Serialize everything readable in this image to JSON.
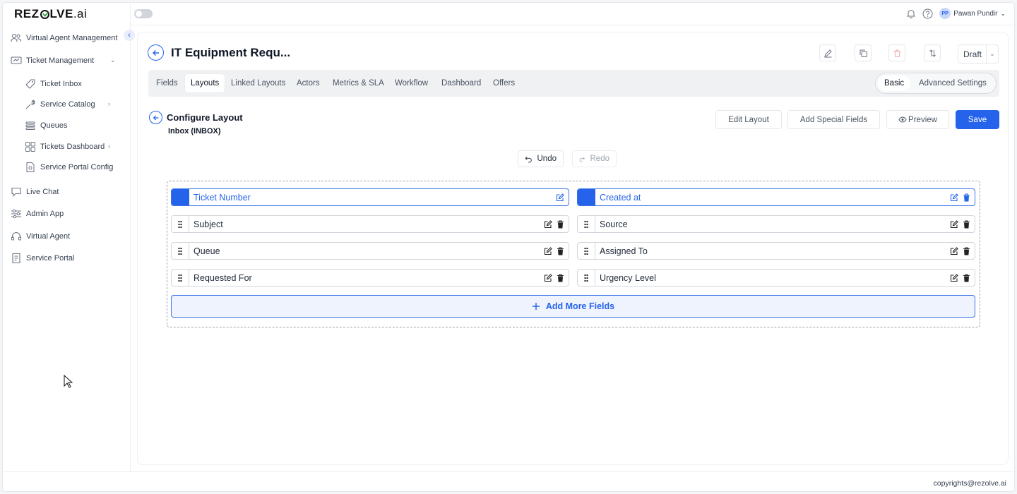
{
  "brand": {
    "logo_pre": "REZ",
    "logo_post": "LVE",
    "logo_ai": ".ai"
  },
  "sidebar": {
    "items": [
      {
        "label": "Virtual Agent Management",
        "icon": "users-gear-icon"
      },
      {
        "label": "Ticket Management",
        "icon": "ticket-screen-icon"
      },
      {
        "label": "Ticket Inbox",
        "icon": "tag-icon"
      },
      {
        "label": "Service Catalog",
        "icon": "wrench-icon"
      },
      {
        "label": "Queues",
        "icon": "stack-icon"
      },
      {
        "label": "Tickets Dashboard",
        "icon": "grid-icon"
      },
      {
        "label": "Service Portal Config",
        "icon": "doc-gear-icon"
      },
      {
        "label": "Live Chat",
        "icon": "chat-icon"
      },
      {
        "label": "Admin App",
        "icon": "sliders-icon"
      },
      {
        "label": "Virtual Agent",
        "icon": "headset-icon"
      },
      {
        "label": "Service Portal",
        "icon": "portal-icon"
      }
    ]
  },
  "topbar": {
    "avatar_initials": "PP",
    "user_name": "Pawan Pundir"
  },
  "header": {
    "title": "IT Equipment Requ...",
    "status": "Draft"
  },
  "tabs": [
    "Fields",
    "Layouts",
    "Linked Layouts",
    "Actors",
    "Metrics & SLA",
    "Workflow",
    "Dashboard",
    "Offers"
  ],
  "active_tab": "Layouts",
  "segmented": {
    "basic": "Basic",
    "advanced": "Advanced Settings"
  },
  "configure": {
    "title": "Configure Layout",
    "subtitle": "Inbox (INBOX)",
    "edit_layout": "Edit Layout",
    "add_special_fields": "Add Special Fields",
    "preview": "Preview",
    "save": "Save",
    "undo": "Undo",
    "redo": "Redo"
  },
  "layout_fields": [
    {
      "label": "Ticket Number",
      "locked": true
    },
    {
      "label": "Created at",
      "locked": true
    },
    {
      "label": "Subject",
      "locked": false
    },
    {
      "label": "Source",
      "locked": false
    },
    {
      "label": "Queue",
      "locked": false
    },
    {
      "label": "Assigned To",
      "locked": false
    },
    {
      "label": "Requested For",
      "locked": false
    },
    {
      "label": "Urgency Level",
      "locked": false
    }
  ],
  "add_more_fields": "Add More Fields",
  "footer": {
    "copyright": "copyrights@rezolve.ai"
  },
  "colors": {
    "accent": "#2563eb",
    "accent_light": "#eef3fd",
    "danger": "#ef4444"
  }
}
